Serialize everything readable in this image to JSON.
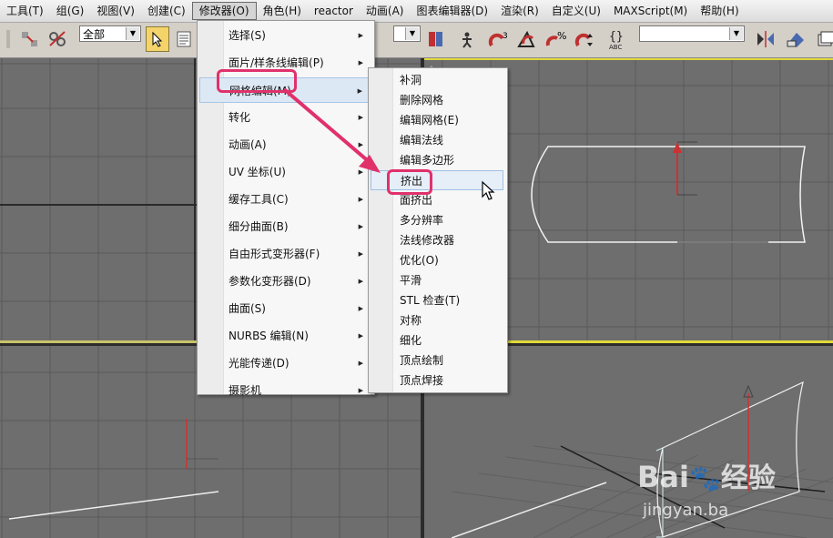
{
  "menubar": {
    "items": [
      "工具(T)",
      "组(G)",
      "视图(V)",
      "创建(C)",
      "修改器(O)",
      "角色(H)",
      "reactor",
      "动画(A)",
      "图表编辑器(D)",
      "渲染(R)",
      "自定义(U)",
      "MAXScript(M)",
      "帮助(H)"
    ],
    "active": "修改器(O)"
  },
  "toolbar": {
    "filter_select": "全部",
    "icons": [
      "select-filter-icon",
      "select-by-name-icon",
      "select-object-icon",
      "select-region-icon",
      "view-select-icon",
      "mirror-icon",
      "angle-snap-icon",
      "percent-snap-icon",
      "spinner-snap-icon",
      "named-selection-icon",
      "align-icon",
      "eraser-icon"
    ]
  },
  "modifier_menu": {
    "items": [
      {
        "label": "选择(S)",
        "submenu": true
      },
      {
        "label": "面片/样条线编辑(P)",
        "submenu": true
      },
      {
        "label": "网格编辑(M)",
        "submenu": true
      },
      {
        "label": "转化",
        "submenu": true
      },
      {
        "label": "动画(A)",
        "submenu": true
      },
      {
        "label": "UV 坐标(U)",
        "submenu": true
      },
      {
        "label": "缓存工具(C)",
        "submenu": true
      },
      {
        "label": "细分曲面(B)",
        "submenu": true
      },
      {
        "label": "自由形式变形器(F)",
        "submenu": true
      },
      {
        "label": "参数化变形器(D)",
        "submenu": true
      },
      {
        "label": "曲面(S)",
        "submenu": true
      },
      {
        "label": "NURBS 编辑(N)",
        "submenu": true
      },
      {
        "label": "光能传递(D)",
        "submenu": true
      },
      {
        "label": "摄影机",
        "submenu": true
      }
    ],
    "highlighted": "网格编辑(M)"
  },
  "mesh_edit_submenu": {
    "items": [
      "补洞",
      "删除网格",
      "编辑网格(E)",
      "编辑法线",
      "编辑多边形",
      "挤出",
      "面挤出",
      "多分辨率",
      "法线修改器",
      "优化(O)",
      "平滑",
      "STL 检查(T)",
      "对称",
      "细化",
      "顶点绘制",
      "顶点焊接"
    ],
    "highlighted": "挤出"
  },
  "watermark": {
    "brand": "Bai",
    "brand2": "经验",
    "url": "jingyan.ba"
  },
  "colors": {
    "highlight_box": "#e0316b",
    "active_viewport": "#e0d93a",
    "viewport_bg": "#6e6e6e"
  }
}
